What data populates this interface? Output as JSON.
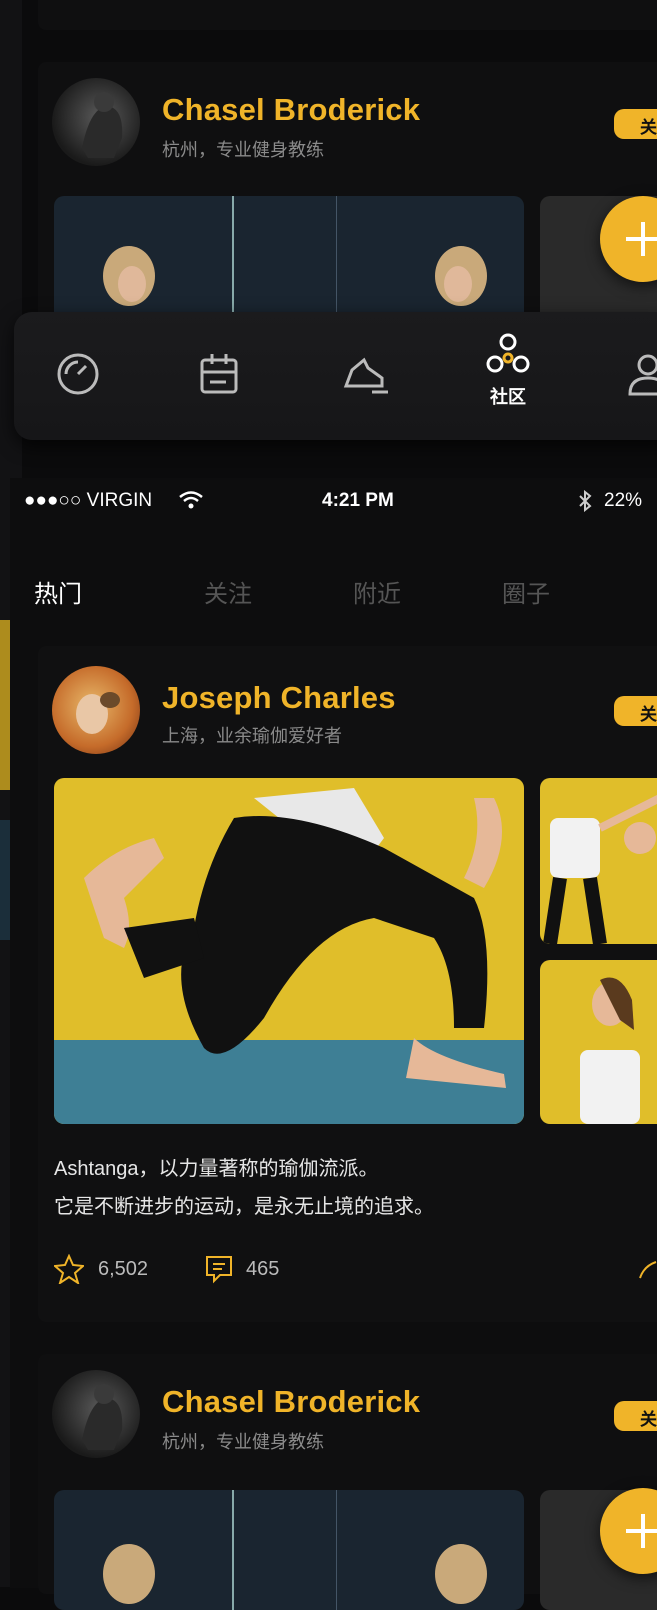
{
  "top_card": {
    "name": "Chasel Broderick",
    "subtitle": "杭州，专业健身教练",
    "follow": "关"
  },
  "tabbar": {
    "items": [
      {
        "icon": "speedometer-icon",
        "label": ""
      },
      {
        "icon": "calendar-icon",
        "label": ""
      },
      {
        "icon": "shoe-icon",
        "label": ""
      },
      {
        "icon": "community-icon",
        "label": "社区"
      },
      {
        "icon": "profile-icon",
        "label": ""
      }
    ]
  },
  "status_bar": {
    "carrier": "●●●○○ VIRGIN",
    "time": "4:21 PM",
    "battery": "22%"
  },
  "segments": [
    "热门",
    "关注",
    "附近",
    "圈子"
  ],
  "post": {
    "name": "Joseph Charles",
    "subtitle": "上海，业余瑜伽爱好者",
    "follow": "关",
    "caption_line1": "Ashtanga，以力量著称的瑜伽流派。",
    "caption_line2": "它是不断进步的运动，是永无止境的追求。",
    "stars": "6,502",
    "comments": "465"
  },
  "bottom_card": {
    "name": "Chasel Broderick",
    "subtitle": "杭州，专业健身教练",
    "follow": "关"
  },
  "colors": {
    "accent": "#f0b429",
    "background": "#0b0b0c"
  }
}
